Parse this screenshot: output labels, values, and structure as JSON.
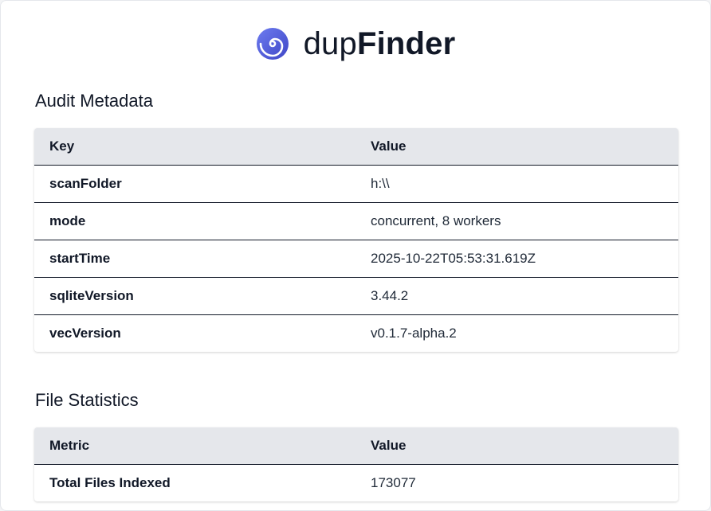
{
  "brand": {
    "light": "dup",
    "bold": "Finder",
    "icon": "spiral-logo-icon",
    "accent": "#4f5bd5"
  },
  "audit_metadata": {
    "title": "Audit Metadata",
    "columns": [
      "Key",
      "Value"
    ],
    "rows": [
      {
        "key": "scanFolder",
        "value": "h:\\\\"
      },
      {
        "key": "mode",
        "value": "concurrent, 8 workers"
      },
      {
        "key": "startTime",
        "value": "2025-10-22T05:53:31.619Z"
      },
      {
        "key": "sqliteVersion",
        "value": "3.44.2"
      },
      {
        "key": "vecVersion",
        "value": "v0.1.7-alpha.2"
      }
    ]
  },
  "file_statistics": {
    "title": "File Statistics",
    "columns": [
      "Metric",
      "Value"
    ],
    "rows": [
      {
        "key": "Total Files Indexed",
        "value": "173077"
      }
    ]
  },
  "colors": {
    "header_row_bg": "#e5e7eb",
    "row_border": "#111827"
  }
}
